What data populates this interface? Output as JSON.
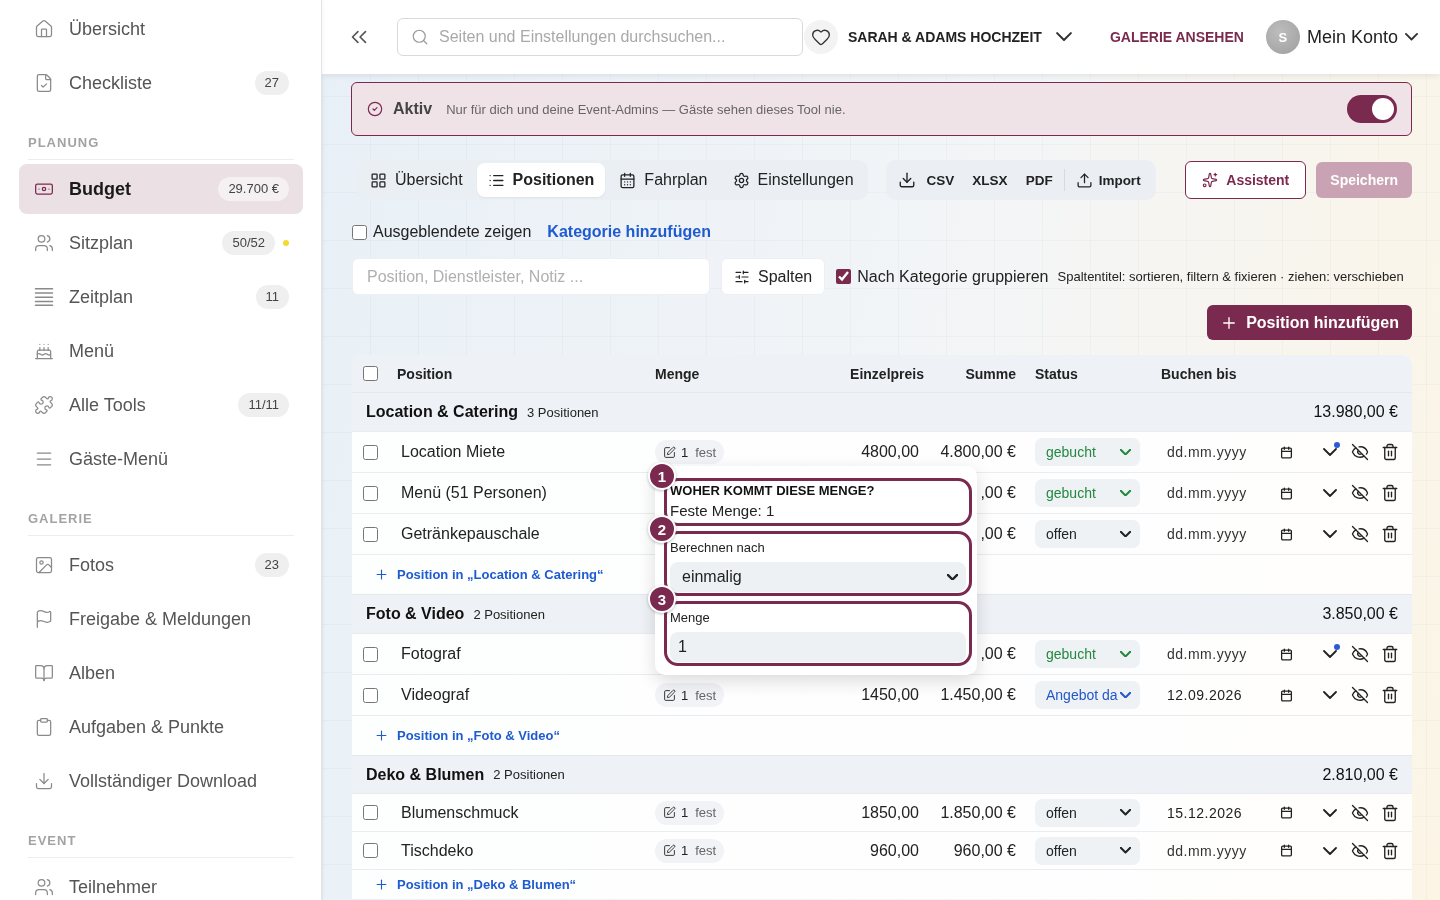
{
  "sidebar": {
    "sections": [
      {
        "items": [
          {
            "label": "Übersicht",
            "selected": false
          },
          {
            "label": "Checkliste",
            "badge": "27",
            "selected": false
          }
        ]
      },
      {
        "heading": "PLANUNG",
        "items": [
          {
            "label": "Budget",
            "badge": "29.700 €",
            "selected": true
          },
          {
            "label": "Sitzplan",
            "badge": "50/52",
            "color": "#f5d833",
            "selected": false
          },
          {
            "label": "Zeitplan",
            "badge": "11",
            "selected": false
          },
          {
            "label": "Menü",
            "selected": false
          },
          {
            "label": "Alle Tools",
            "badge": "11/11",
            "selected": false
          },
          {
            "label": "Gäste-Menü",
            "selected": false
          }
        ]
      },
      {
        "heading": "GALERIE",
        "items": [
          {
            "label": "Fotos",
            "badge": "23",
            "selected": false
          },
          {
            "label": "Freigabe & Meldungen",
            "selected": false
          },
          {
            "label": "Alben",
            "selected": false
          },
          {
            "label": "Aufgaben & Punkte",
            "selected": false
          },
          {
            "label": "Vollständiger Download",
            "selected": false
          }
        ]
      },
      {
        "heading": "EVENT",
        "items": [
          {
            "label": "Teilnehmer",
            "selected": false
          }
        ]
      }
    ]
  },
  "topbar": {
    "search": {
      "placeholder": "Seiten und Einstellungen durchsuchen..."
    },
    "event": "SARAH & ADAMS HOCHZEIT",
    "gallery_link": "GALERIE ANSEHEN",
    "account": {
      "avatar": "S",
      "label": "Mein Konto"
    }
  },
  "banner": {
    "status": "Aktiv",
    "description": "Nur für dich und deine Event-Admins — Gäste sehen dieses Tool nie.",
    "on": true
  },
  "tabs": [
    {
      "label": "Übersicht",
      "selected": false
    },
    {
      "label": "Positionen",
      "selected": true
    },
    {
      "label": "Fahrplan",
      "selected": false
    },
    {
      "label": "Einstellungen",
      "selected": false
    }
  ],
  "export": {
    "formats": [
      "CSV",
      "XLSX",
      "PDF"
    ],
    "import": "Import"
  },
  "assistant_button": "Assistent",
  "save_button": {
    "label": "Speichern",
    "disabled": true
  },
  "filters": {
    "show_hidden": {
      "label": "Ausgeblendete zeigen",
      "checked": false
    },
    "add_category": "Kategorie hinzufügen",
    "search": {
      "placeholder": "Position, Dienstleister, Notiz ..."
    },
    "columns_button": "Spalten",
    "group_by": {
      "label": "Nach Kategorie gruppieren",
      "checked": true
    },
    "hint": "Spaltentitel: sortieren, filtern & fixieren · ziehen: verschieben"
  },
  "add_position_button": "Position hinzufügen",
  "table": {
    "select_all": {
      "checked": false
    },
    "columns": [
      "Position",
      "Menge",
      "Einzelpreis",
      "Summe",
      "Status",
      "Buchen bis"
    ],
    "groups": [
      {
        "name": "Location & Catering",
        "count": "3 Positionen",
        "total": "13.980,00 €",
        "rows": [
          {
            "checked": false,
            "name": "Location Miete",
            "quantity": {
              "amount": "1",
              "mode": "fest"
            },
            "unit_price": "4800,00",
            "total": "4.800,00 €",
            "status": {
              "value": "gebucht",
              "color": "#23883f"
            },
            "date": {
              "placeholder": "dd.mm.yyyy"
            },
            "marked": true
          },
          {
            "checked": false,
            "name": "Menü (51 Personen)",
            "total": ",00 €",
            "status": {
              "value": "gebucht",
              "color": "#23883f"
            },
            "date": {
              "placeholder": "dd.mm.yyyy"
            },
            "marked": false
          },
          {
            "checked": false,
            "name": "Getränkepauschale",
            "total": ",00 €",
            "status": {
              "value": "offen",
              "color": "#222222"
            },
            "date": {
              "placeholder": "dd.mm.yyyy"
            },
            "marked": false
          }
        ],
        "add_label": "Position in „Location & Catering“"
      },
      {
        "name": "Foto & Video",
        "count": "2 Positionen",
        "total": "3.850,00 €",
        "rows": [
          {
            "checked": false,
            "name": "Fotograf",
            "total": ",00 €",
            "status": {
              "value": "gebucht",
              "color": "#23883f"
            },
            "date": {
              "placeholder": "dd.mm.yyyy"
            },
            "marked": true
          },
          {
            "checked": false,
            "name": "Videograf",
            "quantity": {
              "amount": "1",
              "mode": "fest"
            },
            "unit_price": "1450,00",
            "total": "1.450,00 €",
            "status": {
              "value": "Angebot da",
              "color": "#2457c9"
            },
            "date": {
              "value": "12.09.2026"
            },
            "marked": false
          }
        ],
        "add_label": "Position in „Foto & Video“"
      },
      {
        "name": "Deko & Blumen",
        "count": "2 Positionen",
        "total": "2.810,00 €",
        "rows": [
          {
            "checked": false,
            "name": "Blumenschmuck",
            "quantity": {
              "amount": "1",
              "mode": "fest"
            },
            "unit_price": "1850,00",
            "total": "1.850,00 €",
            "status": {
              "value": "offen",
              "color": "#222222"
            },
            "date": {
              "value": "15.12.2026"
            },
            "marked": false
          },
          {
            "checked": false,
            "name": "Tischdeko",
            "quantity": {
              "amount": "1",
              "mode": "fest"
            },
            "unit_price": "960,00",
            "total": "960,00 €",
            "status": {
              "value": "offen",
              "color": "#222222"
            },
            "date": {
              "placeholder": "dd.mm.yyyy"
            },
            "marked": false
          }
        ],
        "add_label": "Position in „Deko & Blumen“"
      }
    ]
  },
  "popover": {
    "steps": [
      {
        "kind": "info",
        "number": "1",
        "title": "WOHER KOMMT DIESE MENGE?",
        "text": "Feste Menge: 1"
      },
      {
        "kind": "select",
        "number": "2",
        "label": "Berechnen nach",
        "value": "einmalig"
      },
      {
        "kind": "input",
        "number": "3",
        "label": "Menge",
        "value": "1"
      }
    ]
  }
}
